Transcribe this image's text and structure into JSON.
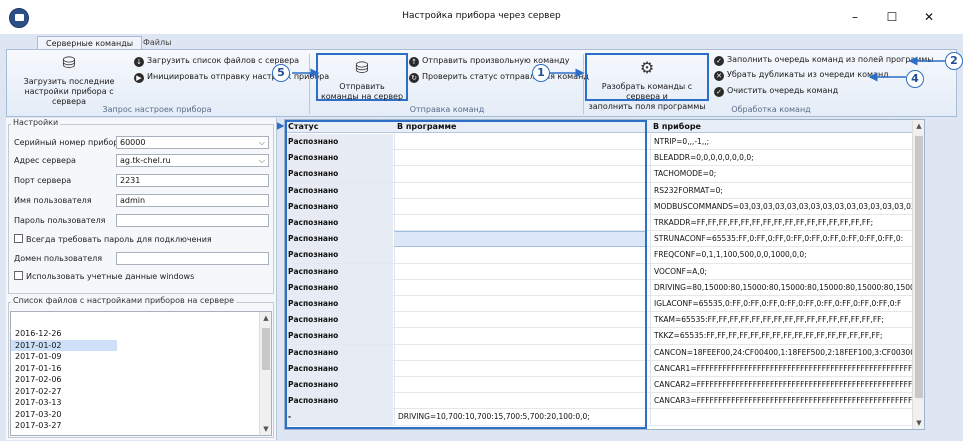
{
  "window": {
    "title": "Настройка прибора через сервер",
    "minimize_glyph": "–",
    "maximize_glyph": "☐",
    "close_glyph": "✕"
  },
  "tabs": [
    {
      "label": "Серверные команды",
      "active": true
    },
    {
      "label": "Файлы",
      "active": false
    }
  ],
  "ribbon": {
    "group1": {
      "caption": "Запрос настроек прибора",
      "big_button": {
        "line1": "Загрузить последние",
        "line2": "настройки прибора с сервера"
      },
      "small1": "Загрузить список файлов с сервера",
      "small2": "Инициировать отправку настроек прибора"
    },
    "group2": {
      "caption": "Отправка команд",
      "big_button": {
        "line1": "Отправить",
        "line2": "команды на сервер"
      },
      "small1": "Отправить произвольную команду",
      "small2": "Проверить статус отправления команд"
    },
    "group3": {
      "caption": "Обработка команд",
      "big_button": {
        "line1": "Разобрать команды с сервера и",
        "line2": "заполнить поля программы"
      },
      "small1": "Заполнить очередь команд из полей программы",
      "small2": "Убрать дубликаты из очереди команд",
      "small3": "Очистить очередь команд"
    }
  },
  "callouts": [
    "1",
    "2",
    "3",
    "4",
    "5"
  ],
  "settings": {
    "title": "Настройки",
    "serial_label": "Серийный номер прибора",
    "serial_value": "60000",
    "server_label": "Адрес сервера",
    "server_value": "ag.tk-chel.ru",
    "port_label": "Порт сервера",
    "port_value": "2231",
    "user_label": "Имя пользователя",
    "user_value": "admin",
    "password_label": "Пароль пользователя",
    "password_value": "",
    "always_password_label": "Всегда требовать пароль для подключения",
    "domain_label": "Домен пользователя",
    "domain_value": "",
    "windows_creds_label": "Использовать учетные данные windows"
  },
  "files": {
    "title": "Список файлов с настройками приборов на сервере",
    "items": [
      "2016-12-26",
      "2017-01-02",
      "2017-01-09",
      "2017-01-16",
      "2017-02-06",
      "2017-02-27",
      "2017-03-13",
      "2017-03-20",
      "2017-03-27"
    ],
    "selected": "2017-01-02"
  },
  "grid": {
    "headers": {
      "status": "Статус",
      "program": "В программе",
      "device": "В приборе"
    },
    "rows": [
      {
        "status": "Распознано",
        "program": "",
        "device": "NTRIP=0,,,-1,,;"
      },
      {
        "status": "Распознано",
        "program": "",
        "device": "BLEADDR=0,0,0,0,0,0,0,0;"
      },
      {
        "status": "Распознано",
        "program": "",
        "device": "TACHOMODE=0;"
      },
      {
        "status": "Распознано",
        "program": "",
        "device": "RS232FORMAT=0;"
      },
      {
        "status": "Распознано",
        "program": "",
        "device": "MODBUSCOMMANDS=03,03,03,03,03,03,03,03,03,03,03,03,03,03,03"
      },
      {
        "status": "Распознано",
        "program": "",
        "device": "TRKADDR=FF,FF,FF,FF,FF,FF,FF,FF,FF,FF,FF,FF,FF,FF,FF,FF;"
      },
      {
        "status": "Распознано",
        "program": "",
        "device": "STRUNACONF=65535:FF,0:FF,0:FF,0:FF,0:FF,0:FF,0:FF,0:FF,0:FF,0:"
      },
      {
        "status": "Распознано",
        "program": "",
        "device": "FREQCONF=0,1,1,100,500,0,0,1000,0,0;"
      },
      {
        "status": "Распознано",
        "program": "",
        "device": "VOCONF=A,0;"
      },
      {
        "status": "Распознано",
        "program": "",
        "device": "DRIVING=80,15000:80,15000:80,15000:80,15000:80,15000:80,1500"
      },
      {
        "status": "Распознано",
        "program": "",
        "device": "IGLACONF=65535,0:FF,0:FF,0:FF,0:FF,0:FF,0:FF,0:FF,0:FF,0:FF,0:F"
      },
      {
        "status": "Распознано",
        "program": "",
        "device": "TKAM=65535:FF,FF,FF,FF,FF,FF,FF,FF,FF,FF,FF,FF,FF,FF,FF,FF;"
      },
      {
        "status": "Распознано",
        "program": "",
        "device": "TKKZ=65535:FF,FF,FF,FF,FF,FF,FF,FF,FF,FF,FF,FF,FF,FF,FF,FF;"
      },
      {
        "status": "Распознано",
        "program": "",
        "device": "CANCON=18FEEF00,24:CF00400,1:18FEF500,2:18FEF100,3:CF00300"
      },
      {
        "status": "Распознано",
        "program": "",
        "device": "CANCAR1=FFFFFFFFFFFFFFFFFFFFFFFFFFFFFFFFFFFFFFFFFFFFFFFFFFFFFFFF"
      },
      {
        "status": "Распознано",
        "program": "",
        "device": "CANCAR2=FFFFFFFFFFFFFFFFFFFFFFFFFFFFFFFFFFFFFFFFFFFFFFFFFFFFFFFF"
      },
      {
        "status": "Распознано",
        "program": "",
        "device": "CANCAR3=FFFFFFFFFFFFFFFFFFFFFFFFFFFFFFFFFFFFFFFFFFFFFFFFFFFFFFFF"
      },
      {
        "status": "-",
        "program": "DRIVING=10,700:10,700:15,700:5,700:20,100:0,0;",
        "device": ""
      }
    ],
    "selected_program_row": 6
  }
}
